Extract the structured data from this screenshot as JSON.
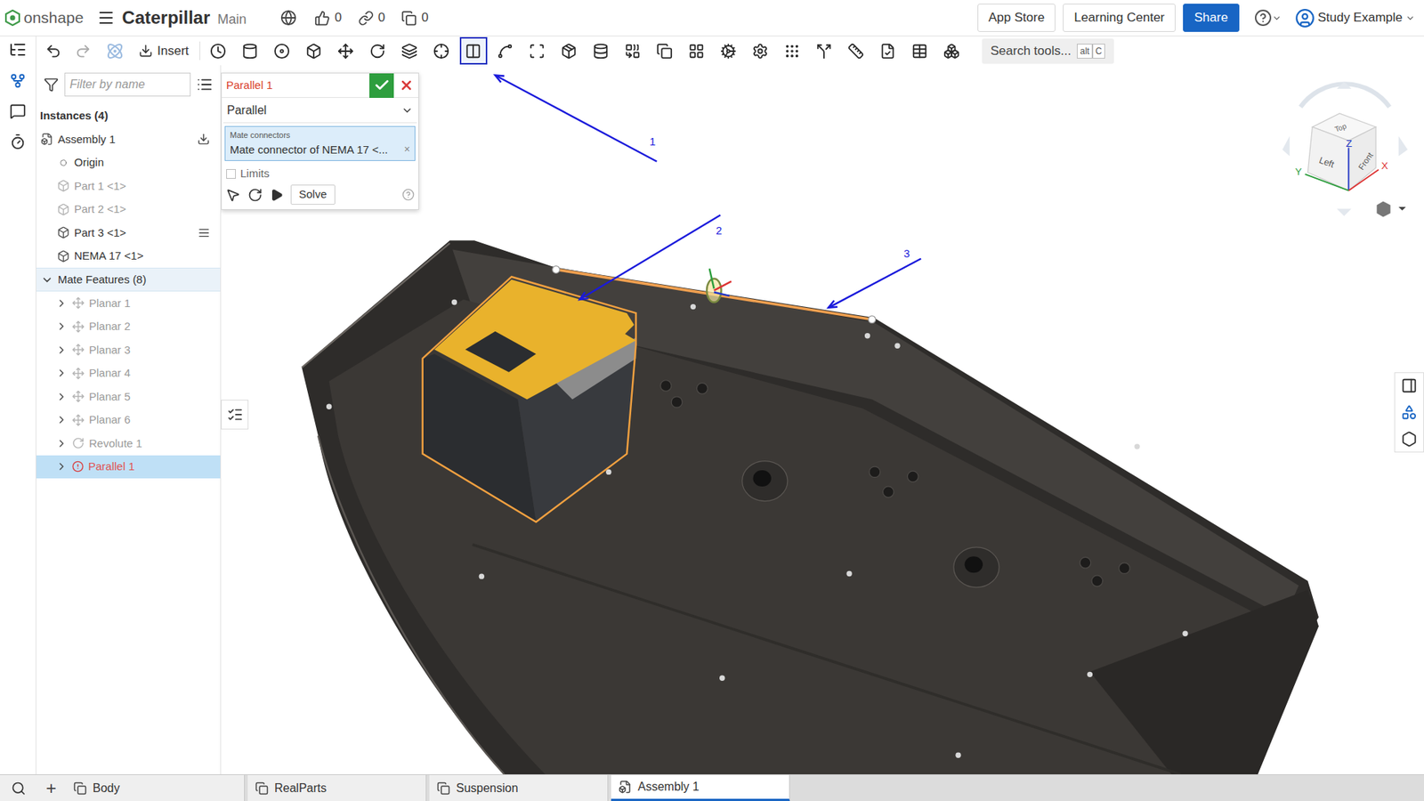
{
  "app": {
    "logo": "onshape"
  },
  "document": {
    "title": "Caterpillar",
    "branch": "Main"
  },
  "counters": [
    {
      "kind": "likes",
      "value": "0"
    },
    {
      "kind": "links",
      "value": "0"
    },
    {
      "kind": "copies",
      "value": "0"
    }
  ],
  "header_buttons": [
    {
      "label": "App Store",
      "primary": false
    },
    {
      "label": "Learning Center",
      "primary": false
    },
    {
      "label": "Share",
      "primary": true
    }
  ],
  "user": {
    "name": "Study Example"
  },
  "toolbar": {
    "insert_label": "Insert",
    "tools": [
      {
        "selected": false
      },
      {
        "selected": false
      },
      {
        "selected": false
      },
      {
        "selected": false
      },
      {
        "selected": false
      },
      {
        "selected": false
      },
      {
        "selected": false
      },
      {
        "selected": false
      },
      {
        "selected": true
      },
      {
        "selected": false
      },
      {
        "selected": false
      },
      {
        "selected": false
      },
      {
        "selected": false
      },
      {
        "selected": false
      },
      {
        "selected": false
      },
      {
        "selected": false
      },
      {
        "selected": false
      },
      {
        "selected": false
      },
      {
        "selected": false
      },
      {
        "selected": false
      },
      {
        "selected": false
      },
      {
        "selected": false
      },
      {
        "selected": false
      },
      {
        "selected": false
      }
    ],
    "search": {
      "placeholder": "Search tools...",
      "keys": [
        "alt",
        "C"
      ]
    }
  },
  "feature_list": {
    "filter_placeholder": "Filter by name",
    "instances": {
      "title": "Instances (4)",
      "items": [
        {
          "label": "Assembly 1",
          "kind": "assembly",
          "greyed": false,
          "trailing": "insert"
        },
        {
          "label": "Origin",
          "kind": "origin",
          "greyed": false,
          "trailing": "none"
        },
        {
          "label": "Part 1 <1>",
          "kind": "part",
          "greyed": true,
          "trailing": "none"
        },
        {
          "label": "Part 2 <1>",
          "kind": "part",
          "greyed": true,
          "trailing": "none"
        },
        {
          "label": "Part 3 <1>",
          "kind": "part",
          "greyed": false,
          "trailing": "fixed"
        },
        {
          "label": "NEMA 17 <1>",
          "kind": "part",
          "greyed": false,
          "trailing": "none"
        }
      ]
    },
    "mates": {
      "title": "Mate Features (8)",
      "expanded": true,
      "items": [
        {
          "label": "Planar 1",
          "kind": "planar",
          "greyed": true,
          "expanded": false,
          "selected": false,
          "error": false
        },
        {
          "label": "Planar 2",
          "kind": "planar",
          "greyed": true,
          "expanded": false,
          "selected": false,
          "error": false
        },
        {
          "label": "Planar 3",
          "kind": "planar",
          "greyed": true,
          "expanded": false,
          "selected": false,
          "error": false
        },
        {
          "label": "Planar 4",
          "kind": "planar",
          "greyed": true,
          "expanded": false,
          "selected": false,
          "error": false
        },
        {
          "label": "Planar 5",
          "kind": "planar",
          "greyed": true,
          "expanded": false,
          "selected": false,
          "error": false
        },
        {
          "label": "Planar 6",
          "kind": "planar",
          "greyed": true,
          "expanded": false,
          "selected": false,
          "error": false
        },
        {
          "label": "Revolute 1",
          "kind": "revolute",
          "greyed": true,
          "expanded": false,
          "selected": false,
          "error": false
        },
        {
          "label": "Parallel 1",
          "kind": "parallel",
          "greyed": false,
          "expanded": false,
          "selected": true,
          "error": true
        }
      ]
    }
  },
  "dialog": {
    "title": "Parallel 1",
    "type": "Parallel",
    "field_label": "Mate connectors",
    "field_value": "Mate connector of NEMA 17 <...",
    "clear": "×",
    "limits": {
      "label": "Limits",
      "checked": false
    },
    "solve": "Solve"
  },
  "annotations": [
    {
      "label": "1"
    },
    {
      "label": "2"
    },
    {
      "label": "3"
    }
  ],
  "view_cube": {
    "faces": {
      "top": "Top",
      "left": "Left",
      "front": "Front"
    },
    "axes": {
      "z": "Z",
      "x": "X",
      "y": "Y"
    }
  },
  "tabs": {
    "add": "+",
    "items": [
      {
        "label": "Body",
        "kind": "part_studio",
        "selected": false
      },
      {
        "label": "RealParts",
        "kind": "part_studio",
        "selected": false
      },
      {
        "label": "Suspension",
        "kind": "part_studio",
        "selected": false
      },
      {
        "label": "Assembly 1",
        "kind": "assembly",
        "selected": true
      }
    ]
  }
}
